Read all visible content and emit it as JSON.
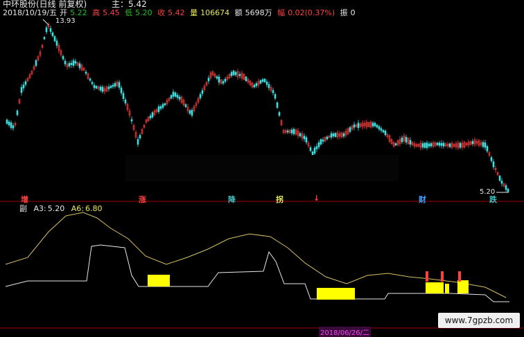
{
  "header": {
    "stock_name": "中环股份(日线 前复权)",
    "ratio_text": "主：5.42"
  },
  "quote": {
    "date": "2018/10/19/五",
    "open_label": "开",
    "open": "5.22",
    "high_label": "高",
    "high": "5.45",
    "low_label": "低",
    "low": "5.20",
    "close_label": "收",
    "close": "5.42",
    "volume_label": "量",
    "volume": "106674",
    "amount_label": "额",
    "amount": "5698万",
    "change_label": "幅",
    "change": "0.02(0.37%)",
    "amplitude_label": "振",
    "amplitude": "0"
  },
  "price_markers": {
    "max": "13.93",
    "min": "5.20"
  },
  "signals": [
    {
      "text": "增",
      "color": "#ff4040"
    },
    {
      "text": "涨",
      "color": "#ff4040"
    },
    {
      "text": "降",
      "color": "#40c0c0"
    },
    {
      "text": "拐",
      "color": "#e8e860"
    },
    {
      "text": "↓",
      "color": "#ff4040"
    },
    {
      "text": "财",
      "color": "#40a0ff"
    },
    {
      "text": "跌",
      "color": "#40c0c0"
    }
  ],
  "sub_chart": {
    "label": "副",
    "a3_label": "A3:",
    "a3": "5.20",
    "a6_label": "A6:",
    "a6": "6.80"
  },
  "footer": {
    "date": "2018/06/26/二"
  },
  "watermark": "www.7gpzb.com",
  "colors": {
    "up": "#ff4040",
    "down": "#40e0e0",
    "line_gold": "#d8c060",
    "line_white": "#e8e8e8",
    "bar_yellow": "#ffff00",
    "divider": "#a00000"
  }
}
